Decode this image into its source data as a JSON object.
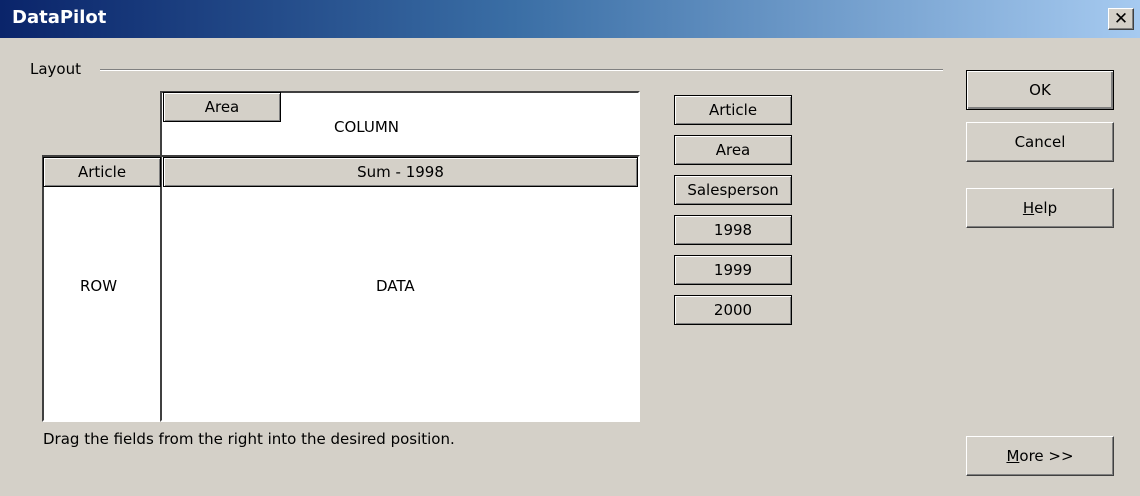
{
  "window": {
    "title": "DataPilot",
    "close_glyph": "✕"
  },
  "layout": {
    "group_label": "Layout",
    "zones": {
      "column": "COLUMN",
      "row": "ROW",
      "data": "DATA"
    },
    "placed": {
      "column_field": "Area",
      "row_field": "Article",
      "data_field": "Sum - 1998"
    },
    "hint": "Drag the fields from the right into the desired position."
  },
  "available_fields": [
    "Article",
    "Area",
    "Salesperson",
    "1998",
    "1999",
    "2000"
  ],
  "buttons": {
    "ok": "OK",
    "cancel": "Cancel",
    "help_first": "H",
    "help_rest": "elp",
    "more_first": "M",
    "more_rest": "ore >>"
  }
}
